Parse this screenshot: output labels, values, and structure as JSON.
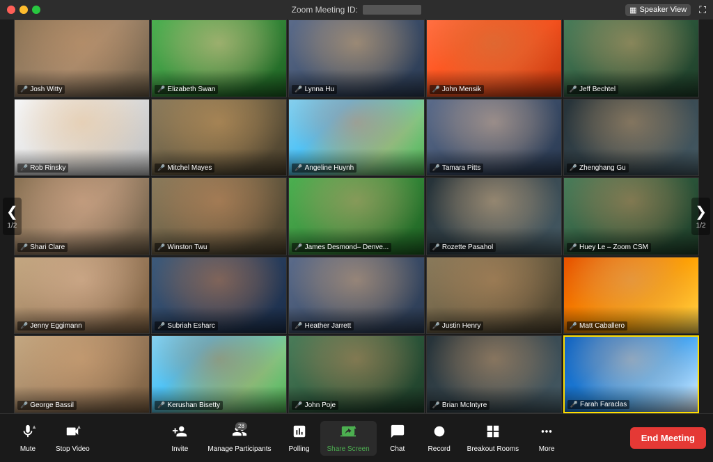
{
  "titlebar": {
    "meeting_label": "Zoom Meeting ID:",
    "meeting_id": "···········",
    "speaker_view_label": "Speaker View"
  },
  "navigation": {
    "left_arrow": "❮",
    "right_arrow": "❯",
    "page_left": "1/2",
    "page_right": "1/2"
  },
  "participants": [
    {
      "name": "Josh Witty",
      "bg": "bg-office1",
      "person_color": "#c4956a",
      "row": 1,
      "col": 1
    },
    {
      "name": "Elizabeth Swan",
      "bg": "bg-green",
      "person_color": "#f0c896",
      "row": 1,
      "col": 2
    },
    {
      "name": "Lynna Hu",
      "bg": "bg-office3",
      "person_color": "#e8b87a",
      "row": 1,
      "col": 3
    },
    {
      "name": "John Mensik",
      "bg": "bg-sunset",
      "person_color": "#c87840",
      "row": 1,
      "col": 4
    },
    {
      "name": "Jeff Bechtel",
      "bg": "bg-office2",
      "person_color": "#d4a870",
      "row": 1,
      "col": 5
    },
    {
      "name": "Rob Rinsky",
      "bg": "bg-light",
      "person_color": "#e8c090",
      "row": 2,
      "col": 1
    },
    {
      "name": "Mitchel Mayes",
      "bg": "bg-office4",
      "person_color": "#d4a060",
      "row": 2,
      "col": 2
    },
    {
      "name": "Angeline Huynh",
      "bg": "bg-outdoor",
      "person_color": "#d08060",
      "row": 2,
      "col": 3
    },
    {
      "name": "Tamara Pitts",
      "bg": "bg-office3",
      "person_color": "#e8c0a0",
      "row": 2,
      "col": 4
    },
    {
      "name": "Zhenghang Gu",
      "bg": "bg-dark",
      "person_color": "#c8a070",
      "row": 2,
      "col": 5
    },
    {
      "name": "Shari Clare",
      "bg": "bg-office1",
      "person_color": "#e0b090",
      "row": 3,
      "col": 1
    },
    {
      "name": "Winston Twu",
      "bg": "bg-office4",
      "person_color": "#d09060",
      "row": 3,
      "col": 2
    },
    {
      "name": "James Desmond– Denve...",
      "bg": "bg-green",
      "person_color": "#c8a070",
      "row": 3,
      "col": 3
    },
    {
      "name": "Rozette Pasahol",
      "bg": "bg-dark",
      "person_color": "#e8c090",
      "row": 3,
      "col": 4
    },
    {
      "name": "Huey Le – Zoom CSM",
      "bg": "bg-office2",
      "person_color": "#c89060",
      "row": 3,
      "col": 5
    },
    {
      "name": "Jenny Eggimann",
      "bg": "bg-home1",
      "person_color": "#e8c0a0",
      "row": 4,
      "col": 1
    },
    {
      "name": "Subriah Esharc",
      "bg": "bg-home2",
      "person_color": "#c88050",
      "row": 4,
      "col": 2
    },
    {
      "name": "Heather Jarrett",
      "bg": "bg-office3",
      "person_color": "#e0b080",
      "row": 4,
      "col": 3
    },
    {
      "name": "Justin Henry",
      "bg": "bg-office4",
      "person_color": "#c09060",
      "row": 4,
      "col": 4
    },
    {
      "name": "Matt Caballero",
      "bg": "bg-autumn",
      "person_color": "#d4a070",
      "row": 4,
      "col": 5
    },
    {
      "name": "George Bassil",
      "bg": "bg-home1",
      "person_color": "#d8a878",
      "row": 5,
      "col": 1
    },
    {
      "name": "Kerushan Bisetty",
      "bg": "bg-outdoor",
      "person_color": "#b07840",
      "row": 5,
      "col": 2
    },
    {
      "name": "John Poje",
      "bg": "bg-office2",
      "person_color": "#c89060",
      "row": 5,
      "col": 3
    },
    {
      "name": "Brian McIntyre",
      "bg": "bg-dark",
      "person_color": "#d0a070",
      "row": 5,
      "col": 4
    },
    {
      "name": "Farah Faraclas",
      "bg": "bg-mountains",
      "person_color": "#e8c0a0",
      "active": true,
      "row": 5,
      "col": 5
    }
  ],
  "toolbar": {
    "mute_label": "Mute",
    "stop_video_label": "Stop Video",
    "invite_label": "Invite",
    "manage_participants_label": "Manage Participants",
    "participants_count": "28",
    "polling_label": "Polling",
    "share_screen_label": "Share Screen",
    "chat_label": "Chat",
    "record_label": "Record",
    "breakout_rooms_label": "Breakout Rooms",
    "more_label": "More",
    "end_meeting_label": "End Meeting"
  }
}
